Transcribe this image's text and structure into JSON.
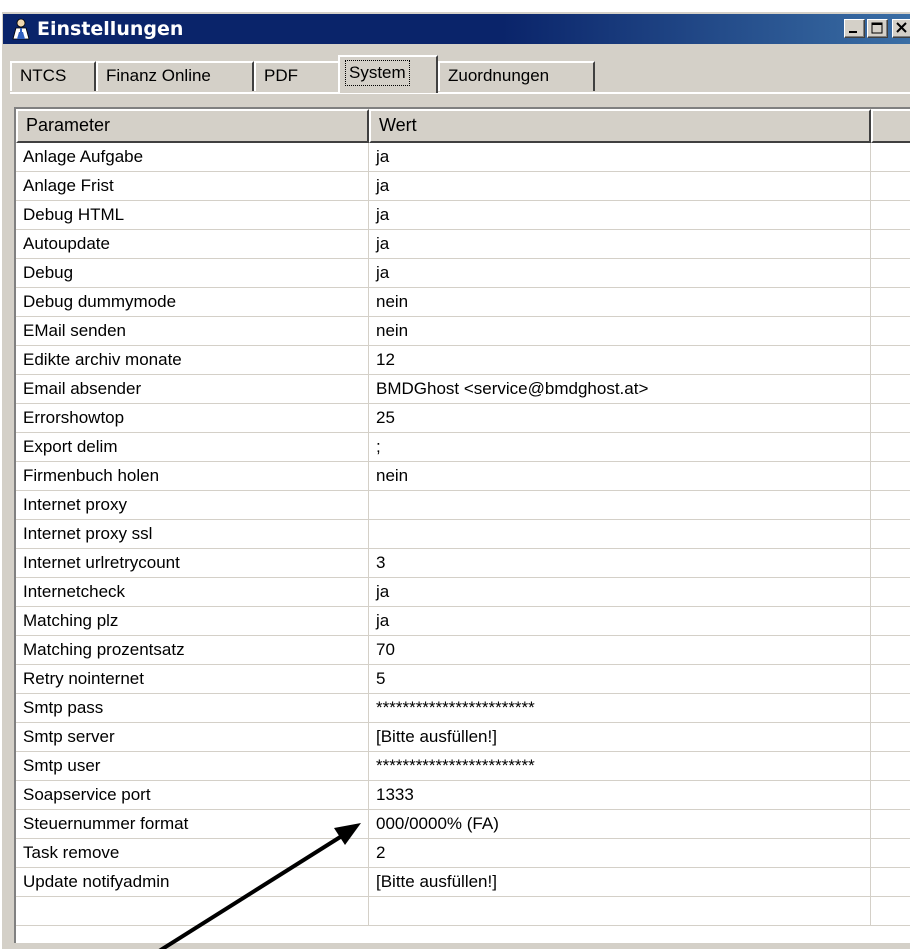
{
  "window": {
    "title": "Einstellungen"
  },
  "tabs": [
    {
      "label": "NTCS"
    },
    {
      "label": "Finanz Online"
    },
    {
      "label": "PDF"
    },
    {
      "label": "System",
      "active": true
    },
    {
      "label": "Zuordnungen"
    }
  ],
  "table": {
    "columns": [
      "Parameter",
      "Wert"
    ],
    "rows": [
      [
        "Anlage Aufgabe",
        "ja"
      ],
      [
        "Anlage Frist",
        "ja"
      ],
      [
        "Debug HTML",
        "ja"
      ],
      [
        "Autoupdate",
        "ja"
      ],
      [
        "Debug",
        "ja"
      ],
      [
        "Debug dummymode",
        "nein"
      ],
      [
        "EMail senden",
        "nein"
      ],
      [
        "Edikte archiv monate",
        "12"
      ],
      [
        "Email absender",
        "BMDGhost <service@bmdghost.at>"
      ],
      [
        "Errorshowtop",
        "25"
      ],
      [
        "Export delim",
        ";"
      ],
      [
        "Firmenbuch holen",
        "nein"
      ],
      [
        "Internet proxy",
        ""
      ],
      [
        "Internet proxy ssl",
        ""
      ],
      [
        "Internet urlretrycount",
        "3"
      ],
      [
        "Internetcheck",
        "ja"
      ],
      [
        "Matching plz",
        "ja"
      ],
      [
        "Matching prozentsatz",
        "70"
      ],
      [
        "Retry nointernet",
        "5"
      ],
      [
        "Smtp pass",
        "************************"
      ],
      [
        "Smtp server",
        "[Bitte ausfüllen!]"
      ],
      [
        "Smtp user",
        "************************"
      ],
      [
        "Soapservice port",
        "1333"
      ],
      [
        "Steuernummer format",
        "000/0000% (FA)"
      ],
      [
        "Task remove",
        "2"
      ],
      [
        "Update notifyadmin",
        "[Bitte ausfüllen!]"
      ],
      [
        "",
        ""
      ]
    ]
  },
  "colors": {
    "titlebar": "#0a246a",
    "face": "#d4d0c8",
    "grid": "#d4d0c8"
  },
  "icons": {
    "app": "user-admin-icon",
    "minimize": "minimize-icon",
    "maximize": "maximize-icon",
    "close": "close-icon"
  }
}
